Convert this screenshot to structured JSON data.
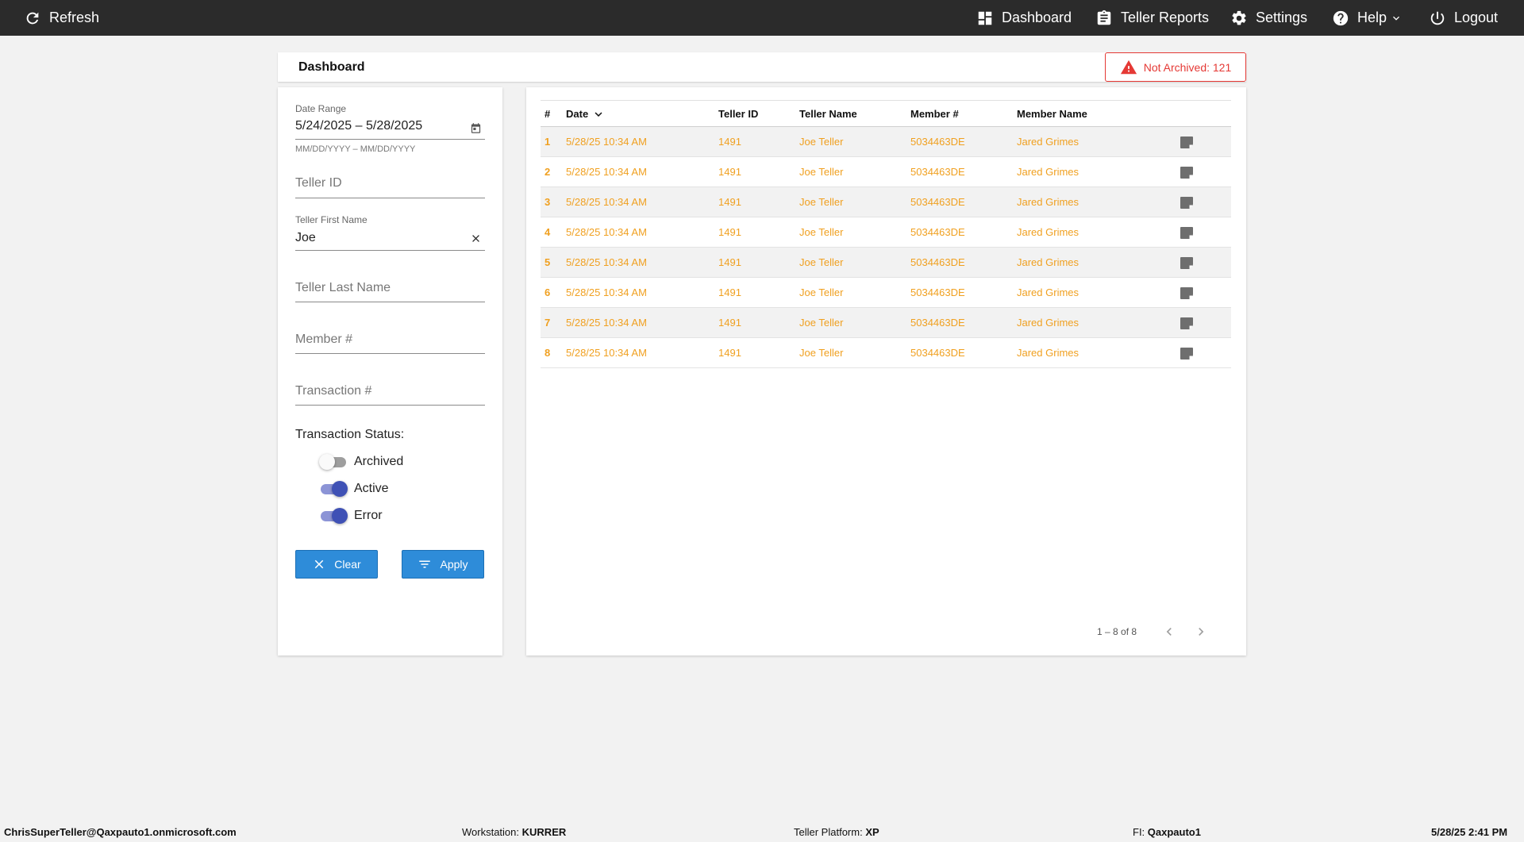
{
  "topbar": {
    "refresh_label": "Refresh",
    "dashboard_label": "Dashboard",
    "reports_label": "Teller Reports",
    "settings_label": "Settings",
    "help_label": "Help",
    "logout_label": "Logout"
  },
  "header": {
    "title": "Dashboard",
    "alert_text": "Not Archived: 121"
  },
  "filters": {
    "date_range_label": "Date Range",
    "date_range_value": "5/24/2025 – 5/28/2025",
    "date_range_hint": "MM/DD/YYYY – MM/DD/YYYY",
    "teller_id_placeholder": "Teller ID",
    "teller_first_label": "Teller First Name",
    "teller_first_value": "Joe",
    "teller_last_placeholder": "Teller Last Name",
    "member_placeholder": "Member #",
    "transaction_placeholder": "Transaction #",
    "status_title": "Transaction Status:",
    "statuses": [
      {
        "label": "Archived",
        "on": false
      },
      {
        "label": "Active",
        "on": true
      },
      {
        "label": "Error",
        "on": true
      }
    ],
    "clear_label": "Clear",
    "apply_label": "Apply"
  },
  "table": {
    "headers": {
      "num": "#",
      "date": "Date",
      "teller_id": "Teller ID",
      "teller_name": "Teller Name",
      "member_num": "Member #",
      "member_name": "Member Name"
    },
    "rows": [
      {
        "num": "1",
        "date": "5/28/25 10:34 AM",
        "teller_id": "1491",
        "teller_name": "Joe Teller",
        "member_num": "5034463DE",
        "member_name": "Jared Grimes"
      },
      {
        "num": "2",
        "date": "5/28/25 10:34 AM",
        "teller_id": "1491",
        "teller_name": "Joe Teller",
        "member_num": "5034463DE",
        "member_name": "Jared Grimes"
      },
      {
        "num": "3",
        "date": "5/28/25 10:34 AM",
        "teller_id": "1491",
        "teller_name": "Joe Teller",
        "member_num": "5034463DE",
        "member_name": "Jared Grimes"
      },
      {
        "num": "4",
        "date": "5/28/25 10:34 AM",
        "teller_id": "1491",
        "teller_name": "Joe Teller",
        "member_num": "5034463DE",
        "member_name": "Jared Grimes"
      },
      {
        "num": "5",
        "date": "5/28/25 10:34 AM",
        "teller_id": "1491",
        "teller_name": "Joe Teller",
        "member_num": "5034463DE",
        "member_name": "Jared Grimes"
      },
      {
        "num": "6",
        "date": "5/28/25 10:34 AM",
        "teller_id": "1491",
        "teller_name": "Joe Teller",
        "member_num": "5034463DE",
        "member_name": "Jared Grimes"
      },
      {
        "num": "7",
        "date": "5/28/25 10:34 AM",
        "teller_id": "1491",
        "teller_name": "Joe Teller",
        "member_num": "5034463DE",
        "member_name": "Jared Grimes"
      },
      {
        "num": "8",
        "date": "5/28/25 10:34 AM",
        "teller_id": "1491",
        "teller_name": "Joe Teller",
        "member_num": "5034463DE",
        "member_name": "Jared Grimes"
      }
    ],
    "pagination": "1 – 8 of 8"
  },
  "footer": {
    "user": "ChrisSuperTeller@Qaxpauto1.onmicrosoft.com",
    "workstation_label": "Workstation:",
    "workstation_value": "KURRER",
    "platform_label": "Teller Platform:",
    "platform_value": "XP",
    "fi_label": "FI:",
    "fi_value": "Qaxpauto1",
    "datetime": "5/28/25 2:41 PM"
  },
  "colors": {
    "topbar_bg": "#2b2b2b",
    "accent_orange": "#f0a020",
    "alert_red": "#e53935",
    "button_blue": "#2e8cd9",
    "toggle_indigo": "#3f51b5"
  },
  "icons": {
    "refresh": "refresh-icon",
    "dashboard": "dashboard-icon",
    "reports": "clipboard-icon",
    "settings": "gear-icon",
    "help": "help-circle-icon",
    "logout": "power-icon",
    "alert": "warning-icon",
    "calendar": "calendar-icon",
    "clear_field": "close-icon",
    "note": "note-icon"
  }
}
